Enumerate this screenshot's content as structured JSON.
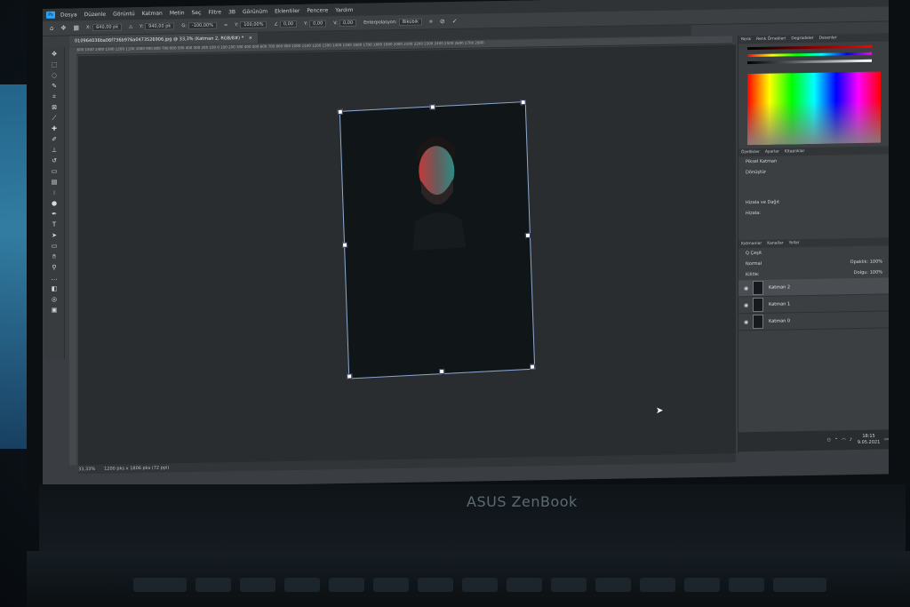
{
  "menubar": {
    "app_badge": "Ps",
    "items": [
      "Dosya",
      "Düzenle",
      "Görüntü",
      "Katman",
      "Metin",
      "Seç",
      "Filtre",
      "3B",
      "Görünüm",
      "Eklentiler",
      "Pencere",
      "Yardım"
    ]
  },
  "options": {
    "x_label": "X:",
    "x_value": "640,00 pk",
    "y_label": "Y:",
    "y_value": "940,00 pk",
    "w_label": "G:",
    "w_value": "-100,00%",
    "h_label": "Y:",
    "h_value": "100,00%",
    "angle_value": "0,00",
    "hskew_label": "Y:",
    "hskew_value": "0,00",
    "vskew_label": "V:",
    "vskew_value": "0,00",
    "interp_label": "Enterpolasyon:",
    "interp_value": "Bikübik"
  },
  "document": {
    "tab_title": "010964036ba06f736b976a0473526906.jpg @ 33,3% (Katman 2, RGB/8#) *"
  },
  "ruler": {
    "ticks": "1600  1500  1400  1300  1200  1100  1000  900  800  700  600  500  400  300  200  100  0  100  200  300  400  500  600  700  800  900  1000  1100  1200  1300  1400  1500  1600  1700  1800  1900  2000  2100  2200  2300  2400  2500  2600  2700  2800"
  },
  "status": {
    "zoom": "33,33%",
    "dimensions": "1200 pks x 1806 pks (72 ppi)"
  },
  "panels": {
    "color_tabs": [
      "Renk",
      "Renk Örnekleri",
      "Degradeler",
      "Desenler"
    ],
    "props_tabs": [
      "Özellikler",
      "Ayarlar",
      "Kitaplıklar"
    ],
    "props_type": "Piksel Katman",
    "transform_title": "Dönüştür",
    "align_title": "Hizala ve Dağıt",
    "align_sub": "Hizala:",
    "layers_tabs": [
      "Katmanlar",
      "Kanallar",
      "Yollar"
    ],
    "search_placeholder": "Q Çeşit",
    "blend_mode": "Normal",
    "opacity_label": "Opaklık:",
    "opacity_value": "100%",
    "lock_label": "Kilitle:",
    "fill_label": "Dolgu:",
    "fill_value": "100%",
    "layers": [
      {
        "name": "Katman 2",
        "selected": true
      },
      {
        "name": "Katman 1",
        "selected": false
      },
      {
        "name": "Katman 0",
        "selected": false
      }
    ]
  },
  "taskbar": {
    "time": "18:15",
    "date": "9.05.2021"
  },
  "brand": {
    "name": "ASUS ZenBook"
  },
  "colors": {
    "accent": "#2aa4ff",
    "selection": "#8aa8d0"
  }
}
